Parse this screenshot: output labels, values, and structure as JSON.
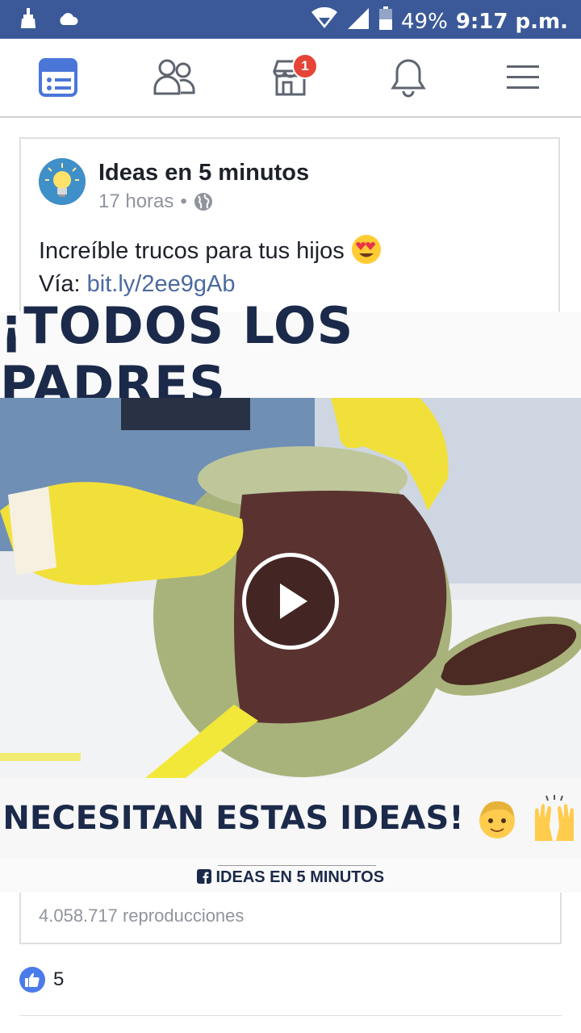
{
  "status_bar": {
    "battery": "49%",
    "time": "9:17 p.m."
  },
  "nav": {
    "items": [
      {
        "name": "news-feed",
        "icon": "newsfeed-icon"
      },
      {
        "name": "friends",
        "icon": "friends-icon"
      },
      {
        "name": "marketplace",
        "icon": "marketplace-icon",
        "badge": "1"
      },
      {
        "name": "notifications",
        "icon": "bell-icon"
      },
      {
        "name": "menu",
        "icon": "hamburger-icon"
      }
    ],
    "accent": "#4a76d8"
  },
  "post": {
    "page_name": "Ideas en 5 minutos",
    "time": "17 horas",
    "separator": "•",
    "text": "Increíble trucos para tus hijos",
    "via_label": "Vía:",
    "link": "bit.ly/2ee9gAb",
    "video": {
      "title_top": "¡TODOS LOS PADRES",
      "title_bottom": "NECESITAN ESTAS IDEAS!",
      "brand": "IDEAS EN 5 MINUTOS"
    },
    "views": "4.058.717 reproducciones",
    "likes": "5"
  },
  "colors": {
    "status_bar_bg": "#3b5998",
    "link": "#4b6aa0",
    "badge": "#e64437"
  }
}
